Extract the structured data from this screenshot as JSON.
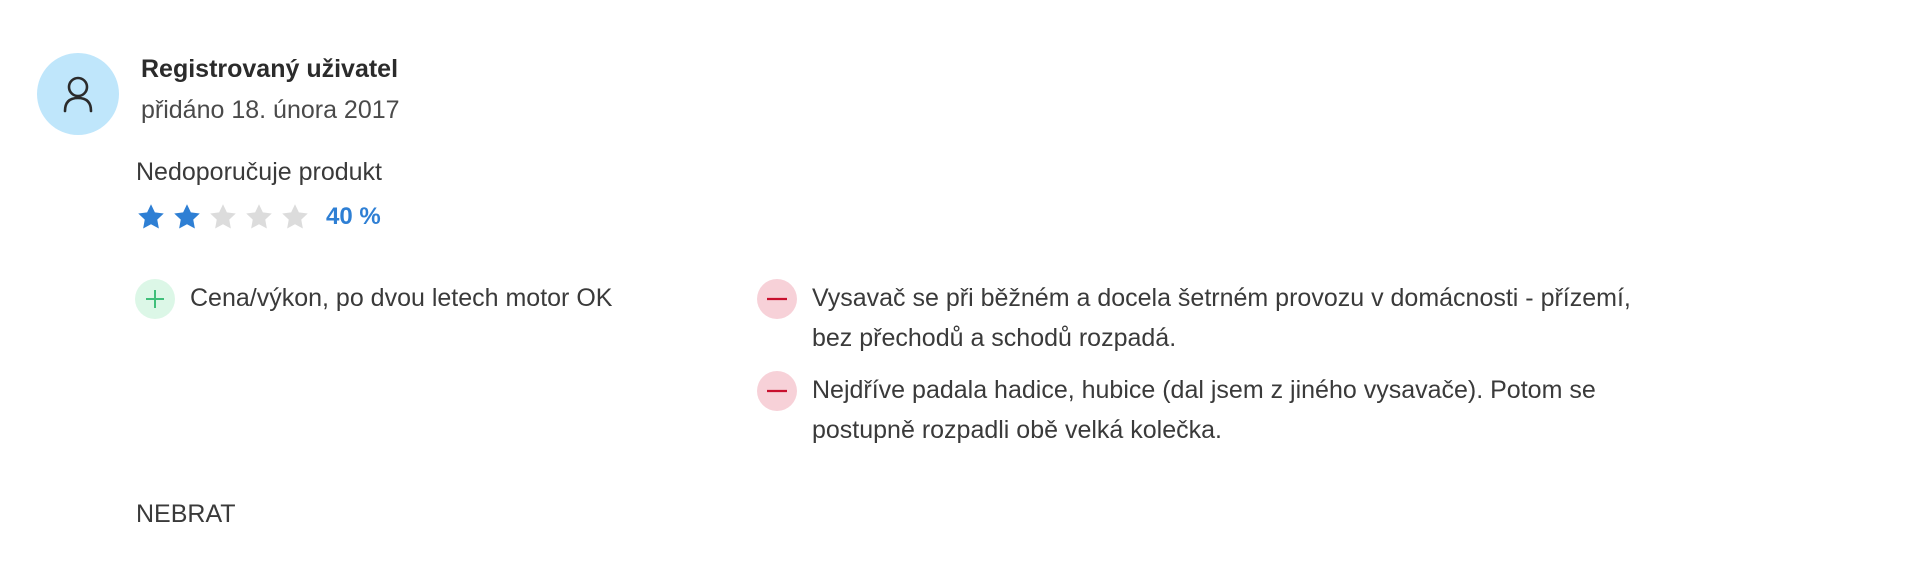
{
  "author": {
    "avatar_icon": "user-icon",
    "name": "Registrovaný uživatel",
    "added": "přidáno 18. února 2017"
  },
  "recommendation": "Nedoporučuje produkt",
  "rating": {
    "stars_filled": 2,
    "stars_total": 5,
    "percent": "40 %",
    "filled_color": "#2e7fd4",
    "empty_color": "#dcdcdc"
  },
  "pros": [
    {
      "icon": "plus-icon",
      "text": "Cena/výkon, po dvou letech motor OK"
    }
  ],
  "cons": [
    {
      "icon": "minus-icon",
      "text": "Vysavač se při běžném a docela šetrném provozu v domácnosti - přízemí, bez přechodů a schodů rozpadá."
    },
    {
      "icon": "minus-icon",
      "text": "Nejdříve padala hadice, hubice (dal jsem z jiného vysavače). Potom se postupně rozpadli obě velká kolečka."
    }
  ],
  "colors": {
    "avatar_bg": "#bfe6fb",
    "pro_badge_bg": "#dcf7e7",
    "pro_icon": "#3fbf7a",
    "con_badge_bg": "#f7d1d8",
    "con_icon": "#c8102e"
  },
  "verdict": "NEBRAT"
}
